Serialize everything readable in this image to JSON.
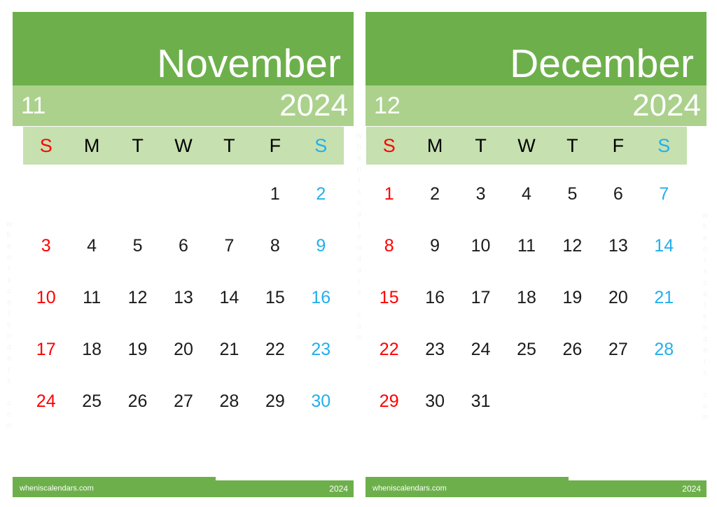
{
  "colors": {
    "header_green": "#6DB04B",
    "sub_green": "#ABD18C",
    "weekday_green": "#C6E0B0",
    "sunday_red": "#FF0000",
    "saturday_blue": "#22AFEC",
    "day_black": "#1B1B1B",
    "page_background": "#FFFFFF"
  },
  "watermark": {
    "text": "wheniscalendars.com",
    "letters": [
      "w",
      "h",
      "e",
      "n",
      "i",
      "s",
      "c",
      "a",
      "l",
      "e",
      "n",
      "d",
      "a",
      "r",
      "s",
      ".",
      "c",
      "o",
      "m"
    ]
  },
  "months": [
    {
      "name": "November",
      "number": "11",
      "year": "2024",
      "weekdays": [
        "S",
        "M",
        "T",
        "W",
        "T",
        "F",
        "S"
      ],
      "weeks": [
        [
          "",
          "",
          "",
          "",
          "",
          "1",
          "2"
        ],
        [
          "3",
          "4",
          "5",
          "6",
          "7",
          "8",
          "9"
        ],
        [
          "10",
          "11",
          "12",
          "13",
          "14",
          "15",
          "16"
        ],
        [
          "17",
          "18",
          "19",
          "20",
          "21",
          "22",
          "23"
        ],
        [
          "24",
          "25",
          "26",
          "27",
          "28",
          "29",
          "30"
        ]
      ],
      "footer": {
        "site": "wheniscalendars.com",
        "year": "2024"
      }
    },
    {
      "name": "December",
      "number": "12",
      "year": "2024",
      "weekdays": [
        "S",
        "M",
        "T",
        "W",
        "T",
        "F",
        "S"
      ],
      "weeks": [
        [
          "1",
          "2",
          "3",
          "4",
          "5",
          "6",
          "7"
        ],
        [
          "8",
          "9",
          "10",
          "11",
          "12",
          "13",
          "14"
        ],
        [
          "15",
          "16",
          "17",
          "18",
          "19",
          "20",
          "21"
        ],
        [
          "22",
          "23",
          "24",
          "25",
          "26",
          "27",
          "28"
        ],
        [
          "29",
          "30",
          "31",
          "",
          "",
          "",
          ""
        ]
      ],
      "footer": {
        "site": "wheniscalendars.com",
        "year": "2024"
      }
    }
  ]
}
